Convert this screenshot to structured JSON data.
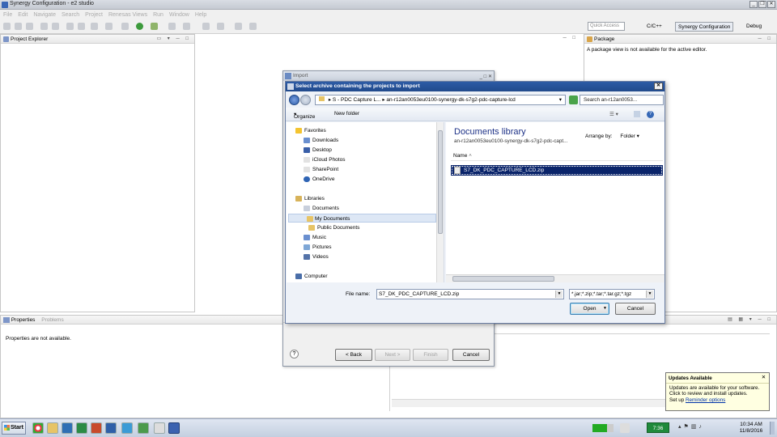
{
  "window": {
    "title": "Synergy Configuration - e2 studio"
  },
  "menu": [
    "File",
    "Edit",
    "Navigate",
    "Search",
    "Project",
    "Renesas Views",
    "Run",
    "Window",
    "Help"
  ],
  "toolbar": {
    "quick_access": "Quick Access",
    "perspectives": [
      "C/C++",
      "Synergy Configuration",
      "Debug"
    ]
  },
  "project_explorer": {
    "title": "Project Explorer"
  },
  "package_view": {
    "title": "Package",
    "message": "A package view is not available for the active editor."
  },
  "properties": {
    "tabs": [
      "Properties",
      "Problems"
    ],
    "message": "Properties are not available."
  },
  "import_dialog": {
    "title": "Import",
    "buttons": {
      "back": "< Back",
      "next": "Next >",
      "finish": "Finish",
      "cancel": "Cancel"
    }
  },
  "file_dialog": {
    "title": "Select archive containing the projects to import",
    "address": [
      "S - PDC Capture L...",
      "an-r12an0053eu0100-synergy-dk-s7g2-pdc-capture-lcd"
    ],
    "search_placeholder": "Search an-r12an0053...",
    "organize": "Organize",
    "new_folder": "New folder",
    "nav": {
      "favorites": "Favorites",
      "favorites_items": [
        "Downloads",
        "Desktop",
        "iCloud Photos",
        "SharePoint",
        "OneDrive"
      ],
      "libraries": "Libraries",
      "documents": "Documents",
      "documents_items": [
        "My Documents",
        "Public Documents"
      ],
      "library_items": [
        "Music",
        "Pictures",
        "Videos"
      ],
      "computer": "Computer"
    },
    "library_title": "Documents library",
    "library_subtitle": "an-r12an0053eu0100-synergy-dk-s7g2-pdc-capt...",
    "arrange_by_label": "Arrange by:",
    "arrange_by_value": "Folder",
    "column_name": "Name",
    "files": [
      "S7_DK_PDC_CAPTURE_LCD.zip"
    ],
    "file_name_label": "File name:",
    "file_name_value": "S7_DK_PDC_CAPTURE_LCD.zip",
    "filter": "*.jar;*.zip;*.tar;*.tar.gz;*.tgz",
    "open": "Open",
    "cancel": "Cancel"
  },
  "updates_popup": {
    "title": "Updates Available",
    "line1": "Updates are available for your software.",
    "line2": "Click to review and install updates.",
    "setup": "Set up",
    "reminder_link": "Reminder options"
  },
  "taskbar": {
    "start": "Start",
    "badge": "7:36",
    "time": "10:34 AM",
    "date": "11/8/2016"
  }
}
